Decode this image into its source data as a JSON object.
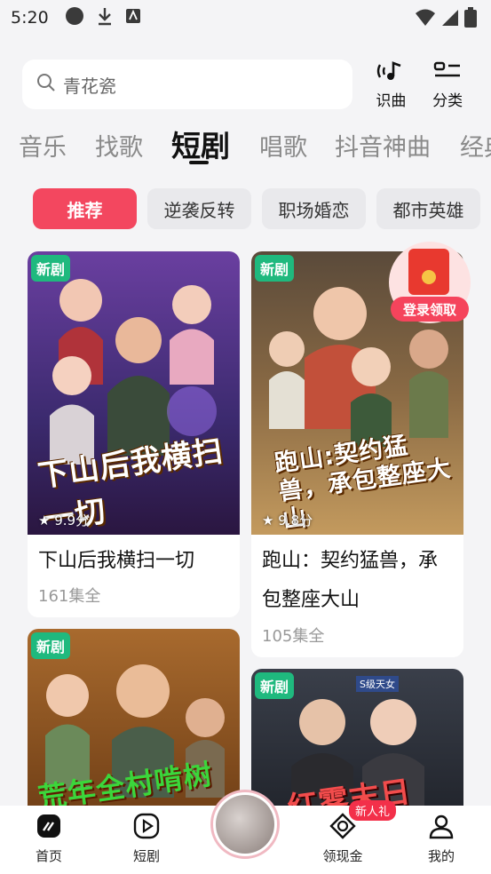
{
  "status_bar": {
    "time": "5:20"
  },
  "search": {
    "placeholder": "青花瓷"
  },
  "top_actions": [
    {
      "label": "识曲",
      "icon": "music-recognize-icon"
    },
    {
      "label": "分类",
      "icon": "category-icon"
    }
  ],
  "tabs": [
    "音乐",
    "找歌",
    "短剧",
    "唱歌",
    "抖音神曲",
    "经典"
  ],
  "active_tab": "短剧",
  "chips": [
    "推荐",
    "逆袭反转",
    "职场婚恋",
    "都市英雄"
  ],
  "promo": {
    "label": "登录领取"
  },
  "cards": [
    {
      "badge": "新剧",
      "rating": "9.9分",
      "title": "下山后我横扫一切",
      "episodes": "161集全",
      "poster_text": "下山后我横扫一切"
    },
    {
      "badge": "新剧",
      "rating": "9.8分",
      "title": "跑山：契约猛兽，承包整座大山",
      "episodes": "105集全",
      "poster_text": "跑山:契约猛兽，承包整座大山"
    },
    {
      "badge": "新剧",
      "poster_text": "荒年全村啃树皮"
    },
    {
      "badge": "新剧",
      "poster_text": "红雾末日",
      "poster_tag": "S级天女"
    }
  ],
  "bottom_nav": [
    {
      "label": "首页",
      "icon": "home-icon"
    },
    {
      "label": "短剧",
      "icon": "play-icon"
    },
    {
      "label": "领现金",
      "icon": "coin-icon"
    },
    {
      "label": "我的",
      "icon": "profile-icon"
    }
  ],
  "nav_badge": "新人礼",
  "colors": {
    "accent": "#f3475f",
    "badge_green": "#1fb97e",
    "background": "#f4f4f6"
  }
}
